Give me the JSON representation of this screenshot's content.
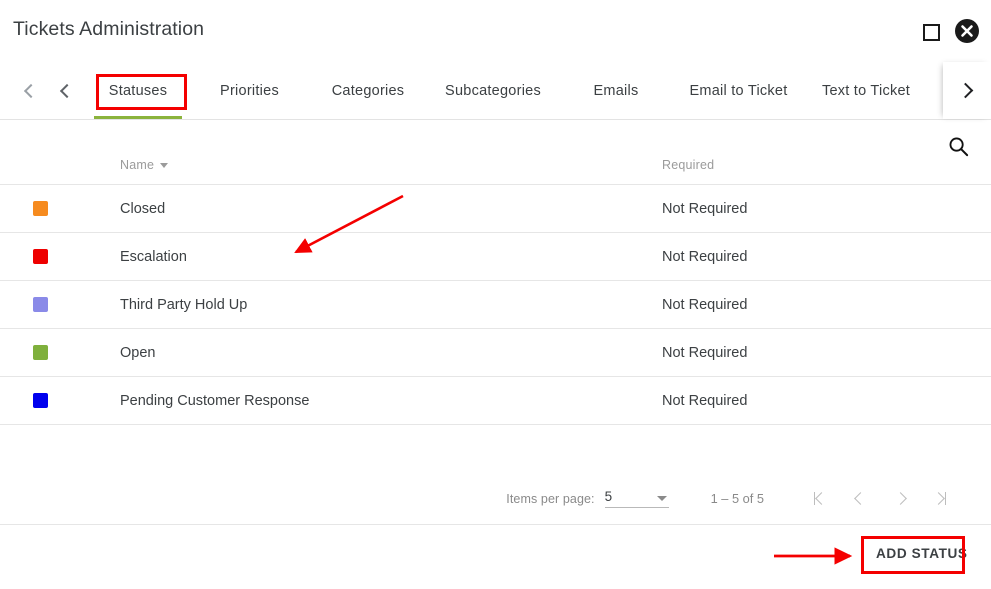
{
  "window": {
    "title": "Tickets Administration",
    "restore_icon": "restore-window-icon",
    "close_icon": "close-circle-icon"
  },
  "tabbar": {
    "scroll_back_first_icon": "chevron-left-icon",
    "scroll_back_icon": "chevron-left-icon",
    "scroll_forward_icon": "chevron-right-icon",
    "active_tab": "Statuses",
    "active_indicator_color": "#8bb33c",
    "tabs": [
      {
        "label": "Statuses"
      },
      {
        "label": "Priorities"
      },
      {
        "label": "Categories"
      },
      {
        "label": "Subcategories"
      },
      {
        "label": "Emails"
      },
      {
        "label": "Email to Ticket"
      },
      {
        "label": "Text to Ticket"
      }
    ]
  },
  "actions": {
    "search_icon": "search-icon",
    "settings_icon": "gear-icon"
  },
  "table": {
    "columns": [
      {
        "key": "name",
        "label": "Name",
        "sorted": true,
        "sort_direction": "desc"
      },
      {
        "key": "required",
        "label": "Required"
      }
    ],
    "rows": [
      {
        "color": "#f68b1f",
        "name": "Closed",
        "required": "Not Required"
      },
      {
        "color": "#ee0000",
        "name": "Escalation",
        "required": "Not Required"
      },
      {
        "color": "#8a8ae8",
        "name": "Third Party Hold Up",
        "required": "Not Required"
      },
      {
        "color": "#7fb03c",
        "name": "Open",
        "required": "Not Required"
      },
      {
        "color": "#0000ee",
        "name": "Pending Customer Response",
        "required": "Not Required"
      }
    ]
  },
  "paginator": {
    "items_per_page_label": "Items per page:",
    "items_per_page_value": "5",
    "dropdown_icon": "chevron-down-icon",
    "range_label": "1 – 5 of 5",
    "first_page_icon": "first-page-icon",
    "previous_page_icon": "chevron-left-icon",
    "next_page_icon": "chevron-right-icon",
    "last_page_icon": "last-page-icon"
  },
  "footer": {
    "add_button_label": "ADD STATUS"
  },
  "annotations": {
    "highlight_color": "#f40000",
    "arrow_to_table": "red-arrow",
    "arrow_to_add_button": "red-arrow",
    "highlight_statuses_tab": "red-box",
    "highlight_add_status_button": "red-box"
  }
}
